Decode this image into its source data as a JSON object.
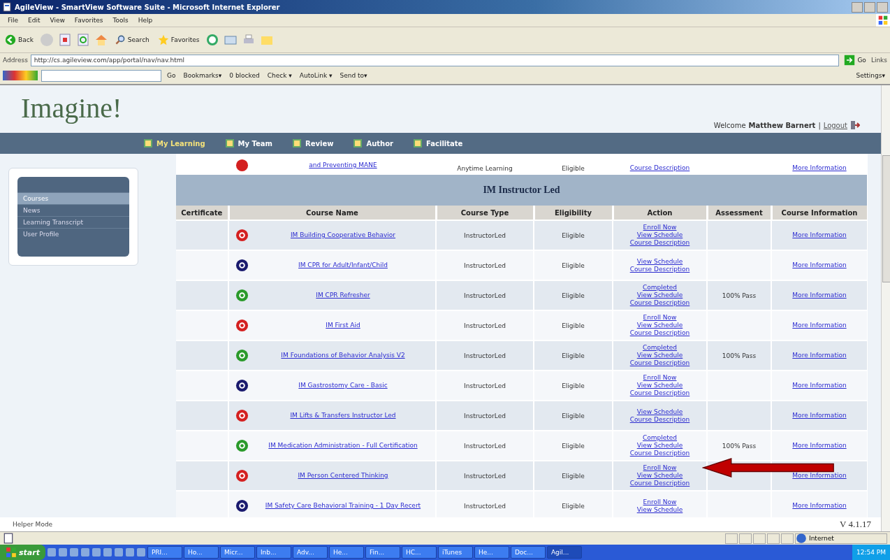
{
  "window": {
    "title": "AgileView - SmartView Software Suite - Microsoft Internet Explorer"
  },
  "menu": [
    "File",
    "Edit",
    "View",
    "Favorites",
    "Tools",
    "Help"
  ],
  "toolbar": {
    "back": "Back",
    "search": "Search",
    "favorites": "Favorites"
  },
  "address": {
    "label": "Address",
    "value": "http://cs.agileview.com/app/portal/nav/nav.html",
    "go": "Go",
    "links": "Links"
  },
  "google_toolbar": {
    "go": "Go",
    "items": [
      "Bookmarks▾",
      "0 blocked",
      "Check ▾",
      "AutoLink ▾",
      "Send to▾"
    ],
    "settings": "Settings▾"
  },
  "header": {
    "logo": "Imagine!",
    "welcome": "Welcome",
    "user": "Matthew Barnert",
    "separator": "|",
    "logout": "Logout"
  },
  "nav": [
    {
      "label": "My Learning",
      "selected": true
    },
    {
      "label": "My Team",
      "selected": false
    },
    {
      "label": "Review",
      "selected": false
    },
    {
      "label": "Author",
      "selected": false
    },
    {
      "label": "Facilitate",
      "selected": false
    }
  ],
  "sidebar": {
    "items": [
      {
        "label": "Courses",
        "selected": true
      },
      {
        "label": "News",
        "selected": false
      },
      {
        "label": "Learning Transcript",
        "selected": false
      },
      {
        "label": "User Profile",
        "selected": false
      }
    ]
  },
  "partial_row": {
    "kind": "incomplete",
    "name": "and Preventing MANE",
    "type": "Anytime Learning",
    "eligibility": "Eligible",
    "actions": [
      "Course Description"
    ],
    "info": "More Information"
  },
  "section": {
    "title": "IM Instructor Led"
  },
  "table": {
    "columns": [
      "Certificate",
      "Course Name",
      "Course Type",
      "Eligibility",
      "Action",
      "Assessment",
      "Course Information"
    ],
    "rows": [
      {
        "kind": "incomplete",
        "name": "IM Building Cooperative Behavior",
        "type": "InstructorLed",
        "eligibility": "Eligible",
        "actions": [
          "Enroll Now",
          "View Schedule",
          "Course Description"
        ],
        "info": "More Information"
      },
      {
        "kind": "scheduled",
        "name": "IM CPR for Adult/Infant/Child",
        "type": "InstructorLed",
        "eligibility": "Eligible",
        "actions": [
          "View Schedule",
          "Course Description"
        ],
        "info": "More Information"
      },
      {
        "kind": "completed",
        "name": "IM CPR Refresher",
        "type": "InstructorLed",
        "eligibility": "Eligible",
        "actions": [
          "Completed",
          "View Schedule",
          "Course Description"
        ],
        "assessment": "100% Pass",
        "info": "More Information"
      },
      {
        "kind": "incomplete",
        "name": "IM First Aid",
        "type": "InstructorLed",
        "eligibility": "Eligible",
        "actions": [
          "Enroll Now",
          "View Schedule",
          "Course Description"
        ],
        "info": "More Information"
      },
      {
        "kind": "completed",
        "name": "IM Foundations of Behavior Analysis V2",
        "type": "InstructorLed",
        "eligibility": "Eligible",
        "actions": [
          "Completed",
          "View Schedule",
          "Course Description"
        ],
        "assessment": "100% Pass",
        "info": "More Information"
      },
      {
        "kind": "scheduled",
        "name": "IM Gastrostomy Care - Basic",
        "type": "InstructorLed",
        "eligibility": "Eligible",
        "actions": [
          "Enroll Now",
          "View Schedule",
          "Course Description"
        ],
        "info": "More Information"
      },
      {
        "kind": "incomplete",
        "name": "IM Lifts & Transfers Instructor Led",
        "type": "InstructorLed",
        "eligibility": "Eligible",
        "actions": [
          "View Schedule",
          "Course Description"
        ],
        "info": "More Information"
      },
      {
        "kind": "completed",
        "name": "IM Medication Administration - Full Certification",
        "type": "InstructorLed",
        "eligibility": "Eligible",
        "actions": [
          "Completed",
          "View Schedule",
          "Course Description"
        ],
        "assessment": "100% Pass",
        "info": "More Information"
      },
      {
        "kind": "incomplete",
        "name": "IM Person Centered Thinking",
        "type": "InstructorLed",
        "eligibility": "Eligible",
        "actions": [
          "Enroll Now",
          "View Schedule",
          "Course Description"
        ],
        "info": "More Information"
      },
      {
        "kind": "scheduled",
        "name": "IM Safety Care Behavioral Training - 1 Day Recert",
        "type": "InstructorLed",
        "eligibility": "Eligible",
        "actions": [
          "Enroll Now",
          "View Schedule"
        ],
        "info": "More Information"
      }
    ]
  },
  "footer": {
    "mode": "Helper Mode",
    "version": "V 4.1.17"
  },
  "status_bar": {
    "zone": "Internet"
  },
  "taskbar": {
    "start": "start",
    "items": [
      "PRI...",
      "Ho...",
      "Micr...",
      "Inb...",
      "Adv...",
      "He...",
      "Fin...",
      "HC...",
      "iTunes",
      "He...",
      "Doc...",
      "Agil..."
    ],
    "clock": "12:54 PM"
  }
}
